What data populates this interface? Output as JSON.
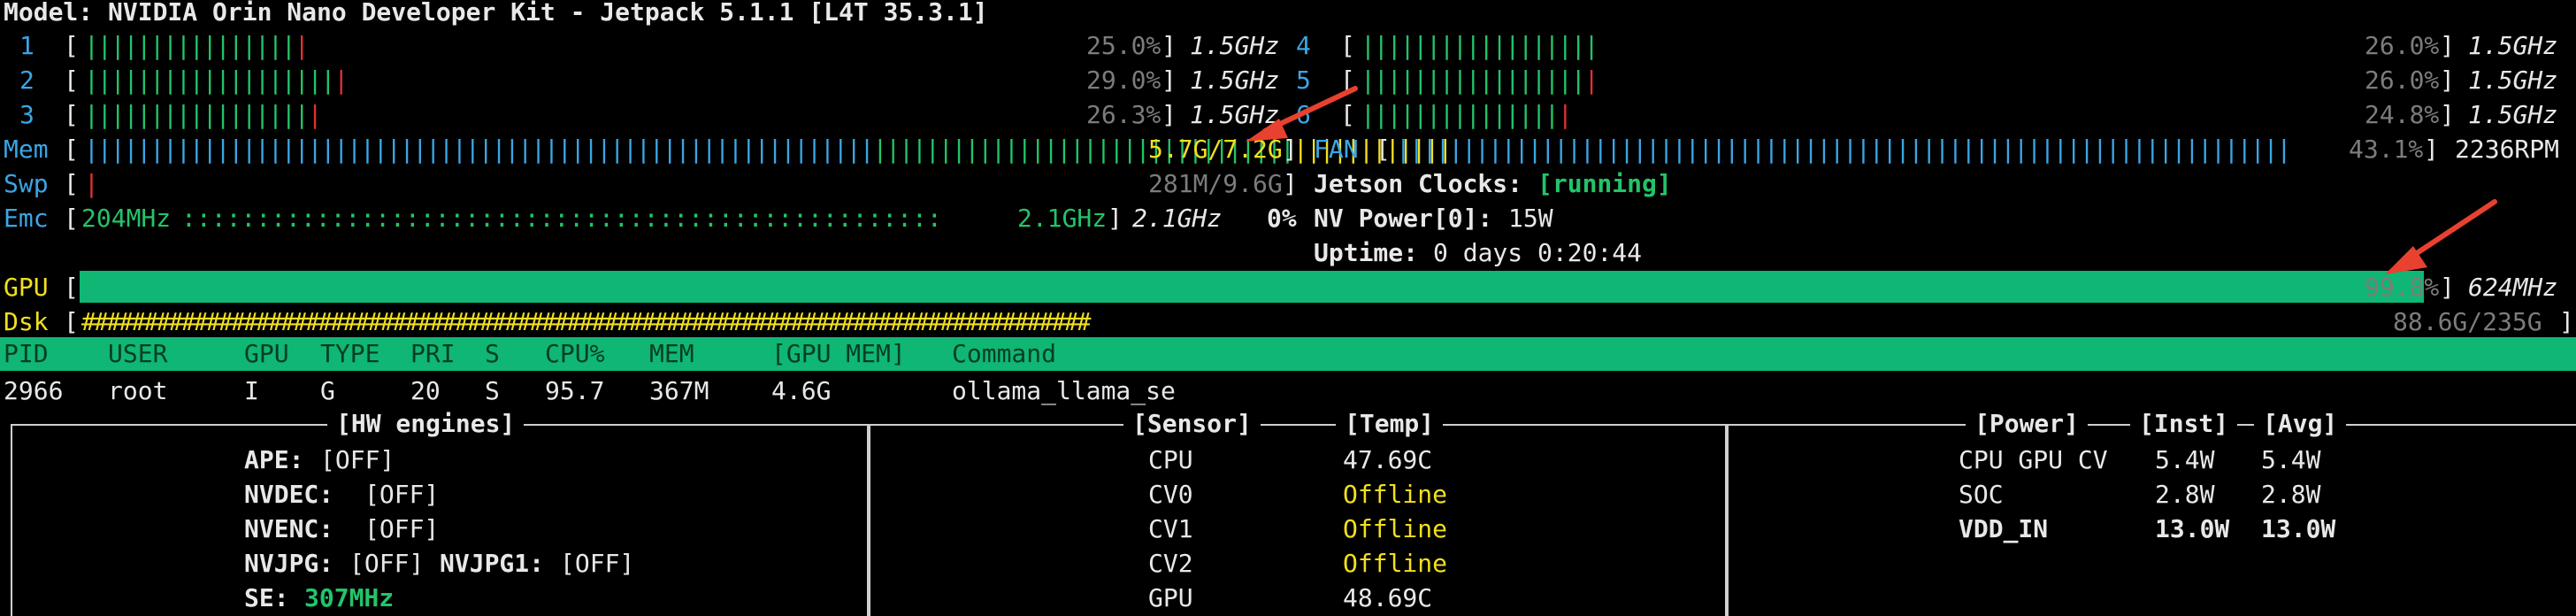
{
  "model": "Model: NVIDIA Orin Nano Developer Kit - Jetpack 5.1.1 [L4T 35.3.1]",
  "cpus": [
    {
      "id": "1",
      "pct": "25.0%",
      "freq": "1.5GHz"
    },
    {
      "id": "2",
      "pct": "29.0%",
      "freq": "1.5GHz"
    },
    {
      "id": "3",
      "pct": "26.3%",
      "freq": "1.5GHz"
    },
    {
      "id": "4",
      "pct": "26.0%",
      "freq": "1.5GHz"
    },
    {
      "id": "5",
      "pct": "26.0%",
      "freq": "1.5GHz"
    },
    {
      "id": "6",
      "pct": "24.8%",
      "freq": "1.5GHz"
    }
  ],
  "mem": {
    "label": "Mem",
    "value": "5.7G/7.2G",
    "fill": 0.79
  },
  "fan": {
    "label": "FAN",
    "pct": "43.1%",
    "rpm": "2236RPM",
    "fill": 0.43
  },
  "swp": {
    "label": "Swp",
    "value": "281M/9.6G"
  },
  "jetson_clocks": {
    "label": "Jetson Clocks:",
    "value": "[running]"
  },
  "emc": {
    "label": "Emc",
    "min": "204MHz",
    "max": "2.1GHz",
    "freq": "2.1GHz",
    "pct": "0%"
  },
  "nv_power": {
    "label": "NV Power[0]:",
    "value": "15W"
  },
  "uptime": {
    "label": "Uptime:",
    "value": "0 days 0:20:44"
  },
  "gpu": {
    "label": "GPU",
    "pct": "99.8%",
    "freq": "624MHz",
    "fill": 0.998
  },
  "dsk": {
    "label": "Dsk",
    "value": "88.6G/235G",
    "fill": 0.37
  },
  "proc_headers": [
    "PID",
    "USER",
    "GPU",
    "TYPE",
    "PRI",
    "S",
    "CPU%",
    "MEM",
    "[GPU MEM]",
    "Command"
  ],
  "proc_rows": [
    [
      "2966",
      "root",
      "I",
      "G",
      "20",
      "S",
      "95.7",
      "367M",
      "4.6G",
      "ollama_llama_se"
    ]
  ],
  "hw_engines": {
    "title": "[HW engines]",
    "ape": {
      "label": "APE:",
      "value": "[OFF]"
    },
    "nvdec": {
      "label": "NVDEC:",
      "value": "[OFF]"
    },
    "nvenc": {
      "label": "NVENC:",
      "value": "[OFF]"
    },
    "nvjpg": {
      "label": "NVJPG:",
      "value": "[OFF]"
    },
    "nvjpg1": {
      "label": "NVJPG1:",
      "value": "[OFF]"
    },
    "se": {
      "label": "SE:",
      "value": "307MHz"
    }
  },
  "sensors": {
    "title_sensor": "[Sensor]",
    "title_temp": "[Temp]",
    "rows": [
      {
        "name": "CPU",
        "temp": "47.69C",
        "offline": false
      },
      {
        "name": "CV0",
        "temp": "Offline",
        "offline": true
      },
      {
        "name": "CV1",
        "temp": "Offline",
        "offline": true
      },
      {
        "name": "CV2",
        "temp": "Offline",
        "offline": true
      },
      {
        "name": "GPU",
        "temp": "48.69C",
        "offline": false
      }
    ]
  },
  "power": {
    "title_power": "[Power]",
    "title_inst": "[Inst]",
    "title_avg": "[Avg]",
    "rows": [
      {
        "name": "CPU GPU CV",
        "inst": "5.4W",
        "avg": "5.4W",
        "bold": false
      },
      {
        "name": "SOC",
        "inst": "2.8W",
        "avg": "2.8W",
        "bold": false
      },
      {
        "name": "VDD_IN",
        "inst": "13.0W",
        "avg": "13.0W",
        "bold": true
      }
    ]
  },
  "colors": {
    "gpu_bar": "#10b673",
    "header_bar": "#10b673",
    "arrow": "#e8412f"
  }
}
